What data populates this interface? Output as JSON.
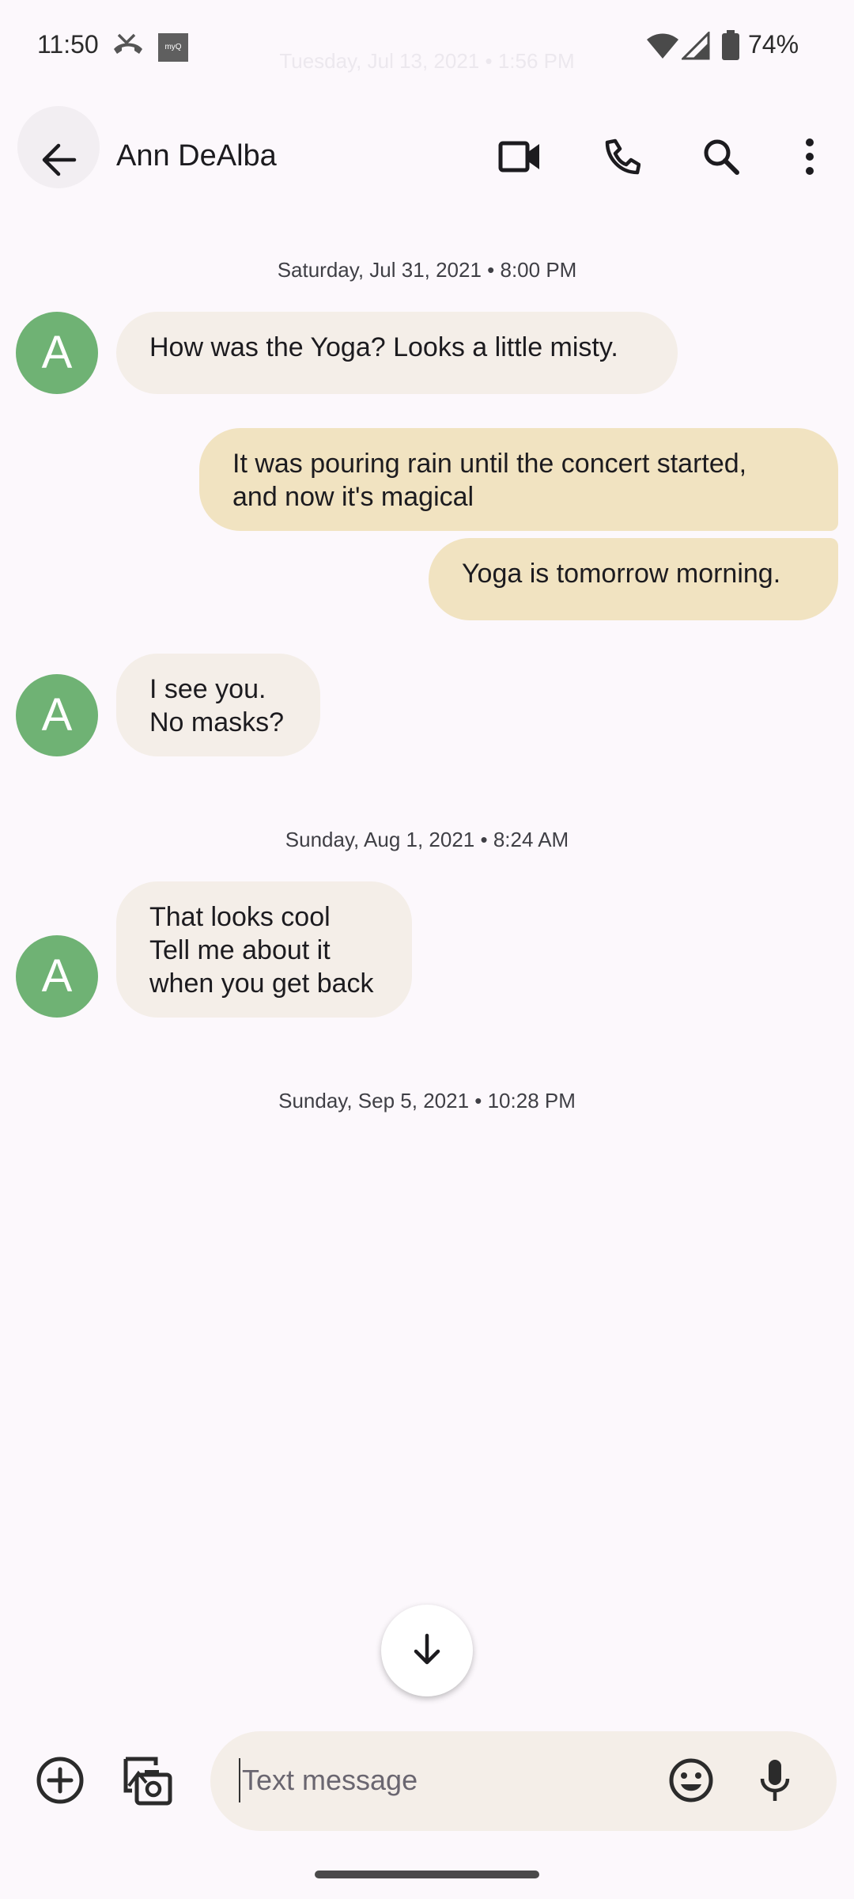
{
  "status_bar": {
    "time": "11:50",
    "battery": "74%",
    "app_badge": "myQ"
  },
  "ghost_date": "Tuesday, Jul 13, 2021 • 1:56 PM",
  "header": {
    "contact_name": "Ann DeAlba",
    "icons": [
      "back-arrow-icon",
      "video-call-icon",
      "phone-icon",
      "search-icon",
      "more-vert-icon"
    ]
  },
  "thread": {
    "date_1": "Saturday, Jul 31, 2021 • 8:00 PM",
    "msg_1": "How was the Yoga?  Looks a little misty.",
    "msg_2": "It was pouring rain until the concert started,\nand now it's magical",
    "msg_3": "Yoga is tomorrow morning.",
    "msg_4": "I see you.\nNo masks?",
    "date_2": "Sunday, Aug 1, 2021 • 8:24 AM",
    "msg_5": "That looks cool\nTell me about it\nwhen you get back",
    "date_3": "Sunday, Sep 5, 2021 • 10:28 PM",
    "avatar_letter": "A"
  },
  "compose": {
    "placeholder": "Text message"
  },
  "colors": {
    "background": "#fcf8fc",
    "incoming_bubble": "#f4eee8",
    "outgoing_bubble": "#f1e3c1",
    "avatar": "#6fb274"
  }
}
